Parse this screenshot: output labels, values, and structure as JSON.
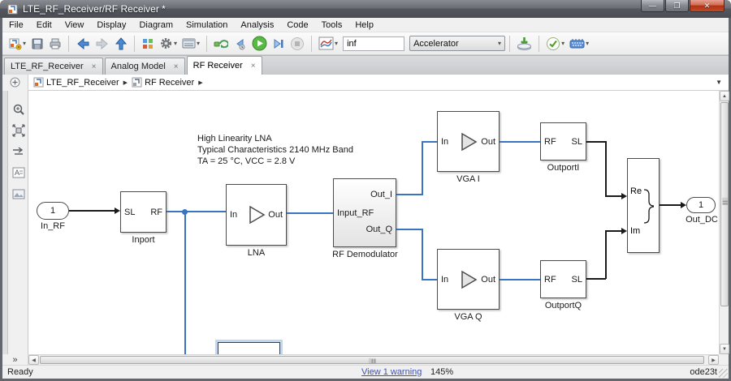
{
  "window": {
    "title": "LTE_RF_Receiver/RF Receiver *",
    "minimize": "—",
    "maximize": "❐",
    "close": "✕"
  },
  "menu": {
    "items": [
      {
        "label": "File"
      },
      {
        "label": "Edit"
      },
      {
        "label": "View"
      },
      {
        "label": "Display"
      },
      {
        "label": "Diagram"
      },
      {
        "label": "Simulation"
      },
      {
        "label": "Analysis"
      },
      {
        "label": "Code"
      },
      {
        "label": "Tools"
      },
      {
        "label": "Help"
      }
    ]
  },
  "toolbar": {
    "sim_time": "inf",
    "sim_mode": "Accelerator",
    "caret": "▾",
    "icons": [
      {
        "name": "new-model-icon"
      },
      {
        "name": "save-icon"
      },
      {
        "name": "print-icon"
      },
      {
        "name": "back-icon"
      },
      {
        "name": "forward-icon"
      },
      {
        "name": "up-to-parent-icon"
      },
      {
        "name": "library-browser-icon"
      },
      {
        "name": "settings-gear-icon"
      },
      {
        "name": "model-explorer-icon"
      },
      {
        "name": "connect-target-icon"
      },
      {
        "name": "step-back-icon"
      },
      {
        "name": "run-icon"
      },
      {
        "name": "step-forward-icon"
      },
      {
        "name": "stop-icon"
      },
      {
        "name": "simulation-display-icon"
      },
      {
        "name": "deploy-icon"
      },
      {
        "name": "update-diagram-check-icon"
      },
      {
        "name": "hardware-board-icon"
      }
    ]
  },
  "tabs": {
    "close_glyph": "×",
    "items": [
      {
        "label": "LTE_RF_Receiver",
        "active": false
      },
      {
        "label": "Analog Model",
        "active": false
      },
      {
        "label": "RF Receiver",
        "active": true
      }
    ]
  },
  "breadcrumb": {
    "separator": "▶",
    "dropdown_glyph": "▼",
    "items": [
      {
        "label": "LTE_RF_Receiver"
      },
      {
        "label": "RF Receiver"
      }
    ]
  },
  "palette": {
    "icons": [
      {
        "name": "zoom-icon"
      },
      {
        "name": "fit-to-view-icon"
      },
      {
        "name": "signal-routing-icon"
      },
      {
        "name": "annotation-icon"
      },
      {
        "name": "screenshot-icon"
      }
    ],
    "expand_glyph": "»"
  },
  "canvas": {
    "annotation": {
      "line1": "High Linearity LNA",
      "line2": "Typical Characteristics 2140 MHz Band",
      "line3": "TA = 25 °C, VCC = 2.8 V"
    },
    "blocks": {
      "in_rf": {
        "port": "1",
        "label": "In_RF"
      },
      "inport": {
        "left_port": "SL",
        "right_port": "RF",
        "label": "Inport"
      },
      "lna": {
        "left_port": "In",
        "right_port": "Out",
        "label": "LNA"
      },
      "rf_demod": {
        "left_port": "Input_RF",
        "out_top": "Out_I",
        "out_bottom": "Out_Q",
        "label": "RF Demodulator"
      },
      "vga_i": {
        "left_port": "In",
        "right_port": "Out",
        "label": "VGA I"
      },
      "outport_i": {
        "left_port": "RF",
        "right_port": "SL",
        "label": "OutportI"
      },
      "vga_q": {
        "left_port": "In",
        "right_port": "Out",
        "label": "VGA Q"
      },
      "outport_q": {
        "left_port": "RF",
        "right_port": "SL",
        "label": "OutportQ"
      },
      "complex": {
        "top_port": "Re",
        "bottom_port": "Im"
      },
      "out_dc": {
        "port": "1",
        "label": "Out_DC"
      }
    },
    "colors": {
      "wire_blue": "#3a74c0",
      "wire_black": "#1a1a1a",
      "selection_glow": "#bcd8f2"
    }
  },
  "statusbar": {
    "ready": "Ready",
    "warning_link": "View 1 warning",
    "zoom_level": "145%",
    "solver": "ode23t"
  }
}
